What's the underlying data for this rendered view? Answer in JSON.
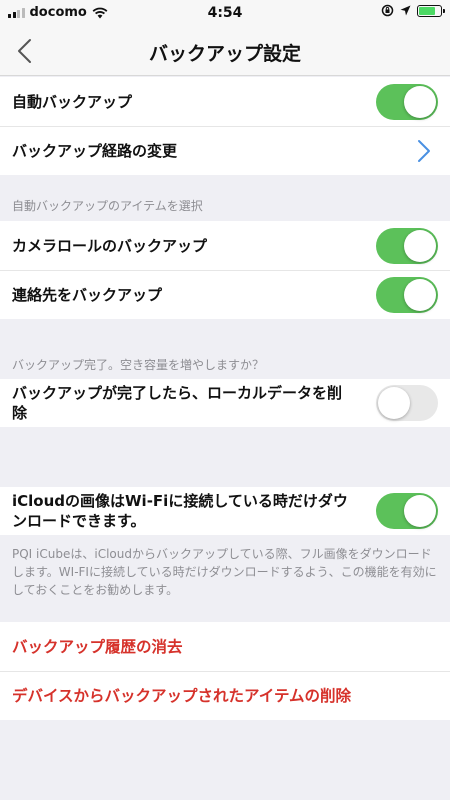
{
  "status_bar": {
    "carrier": "docomo",
    "time": "4:54"
  },
  "nav": {
    "title": "バックアップ設定"
  },
  "section1": {
    "auto_backup_label": "自動バックアップ",
    "auto_backup_on": true,
    "path_change_label": "バックアップ経路の変更"
  },
  "section2": {
    "header": "自動バックアップのアイテムを選択",
    "camera_roll_label": "カメラロールのバックアップ",
    "camera_roll_on": true,
    "contacts_label": "連絡先をバックアップ",
    "contacts_on": true
  },
  "section3": {
    "header": "バックアップ完了。空き容量を増やしますか？",
    "delete_local_label": "バックアップが完了したら、ローカルデータを削除",
    "delete_local_on": false
  },
  "section4": {
    "icloud_label": "iCloudの画像はWi-Fiに接続している時だけダウンロードできます。",
    "icloud_on": true,
    "footer": "PQI iCubeは、iCloudからバックアップしている際、フル画像をダウンロードします。WI-FIに接続している時だけダウンロードするよう、この機能を有効にしておくことをお勧めします。"
  },
  "section5": {
    "clear_history_label": "バックアップ履歴の消去",
    "delete_items_label": "デバイスからバックアップされたアイテムの削除"
  },
  "colors": {
    "switch_on": "#5cc15a",
    "destructive": "#d6322b",
    "chevron": "#4a90e2"
  }
}
